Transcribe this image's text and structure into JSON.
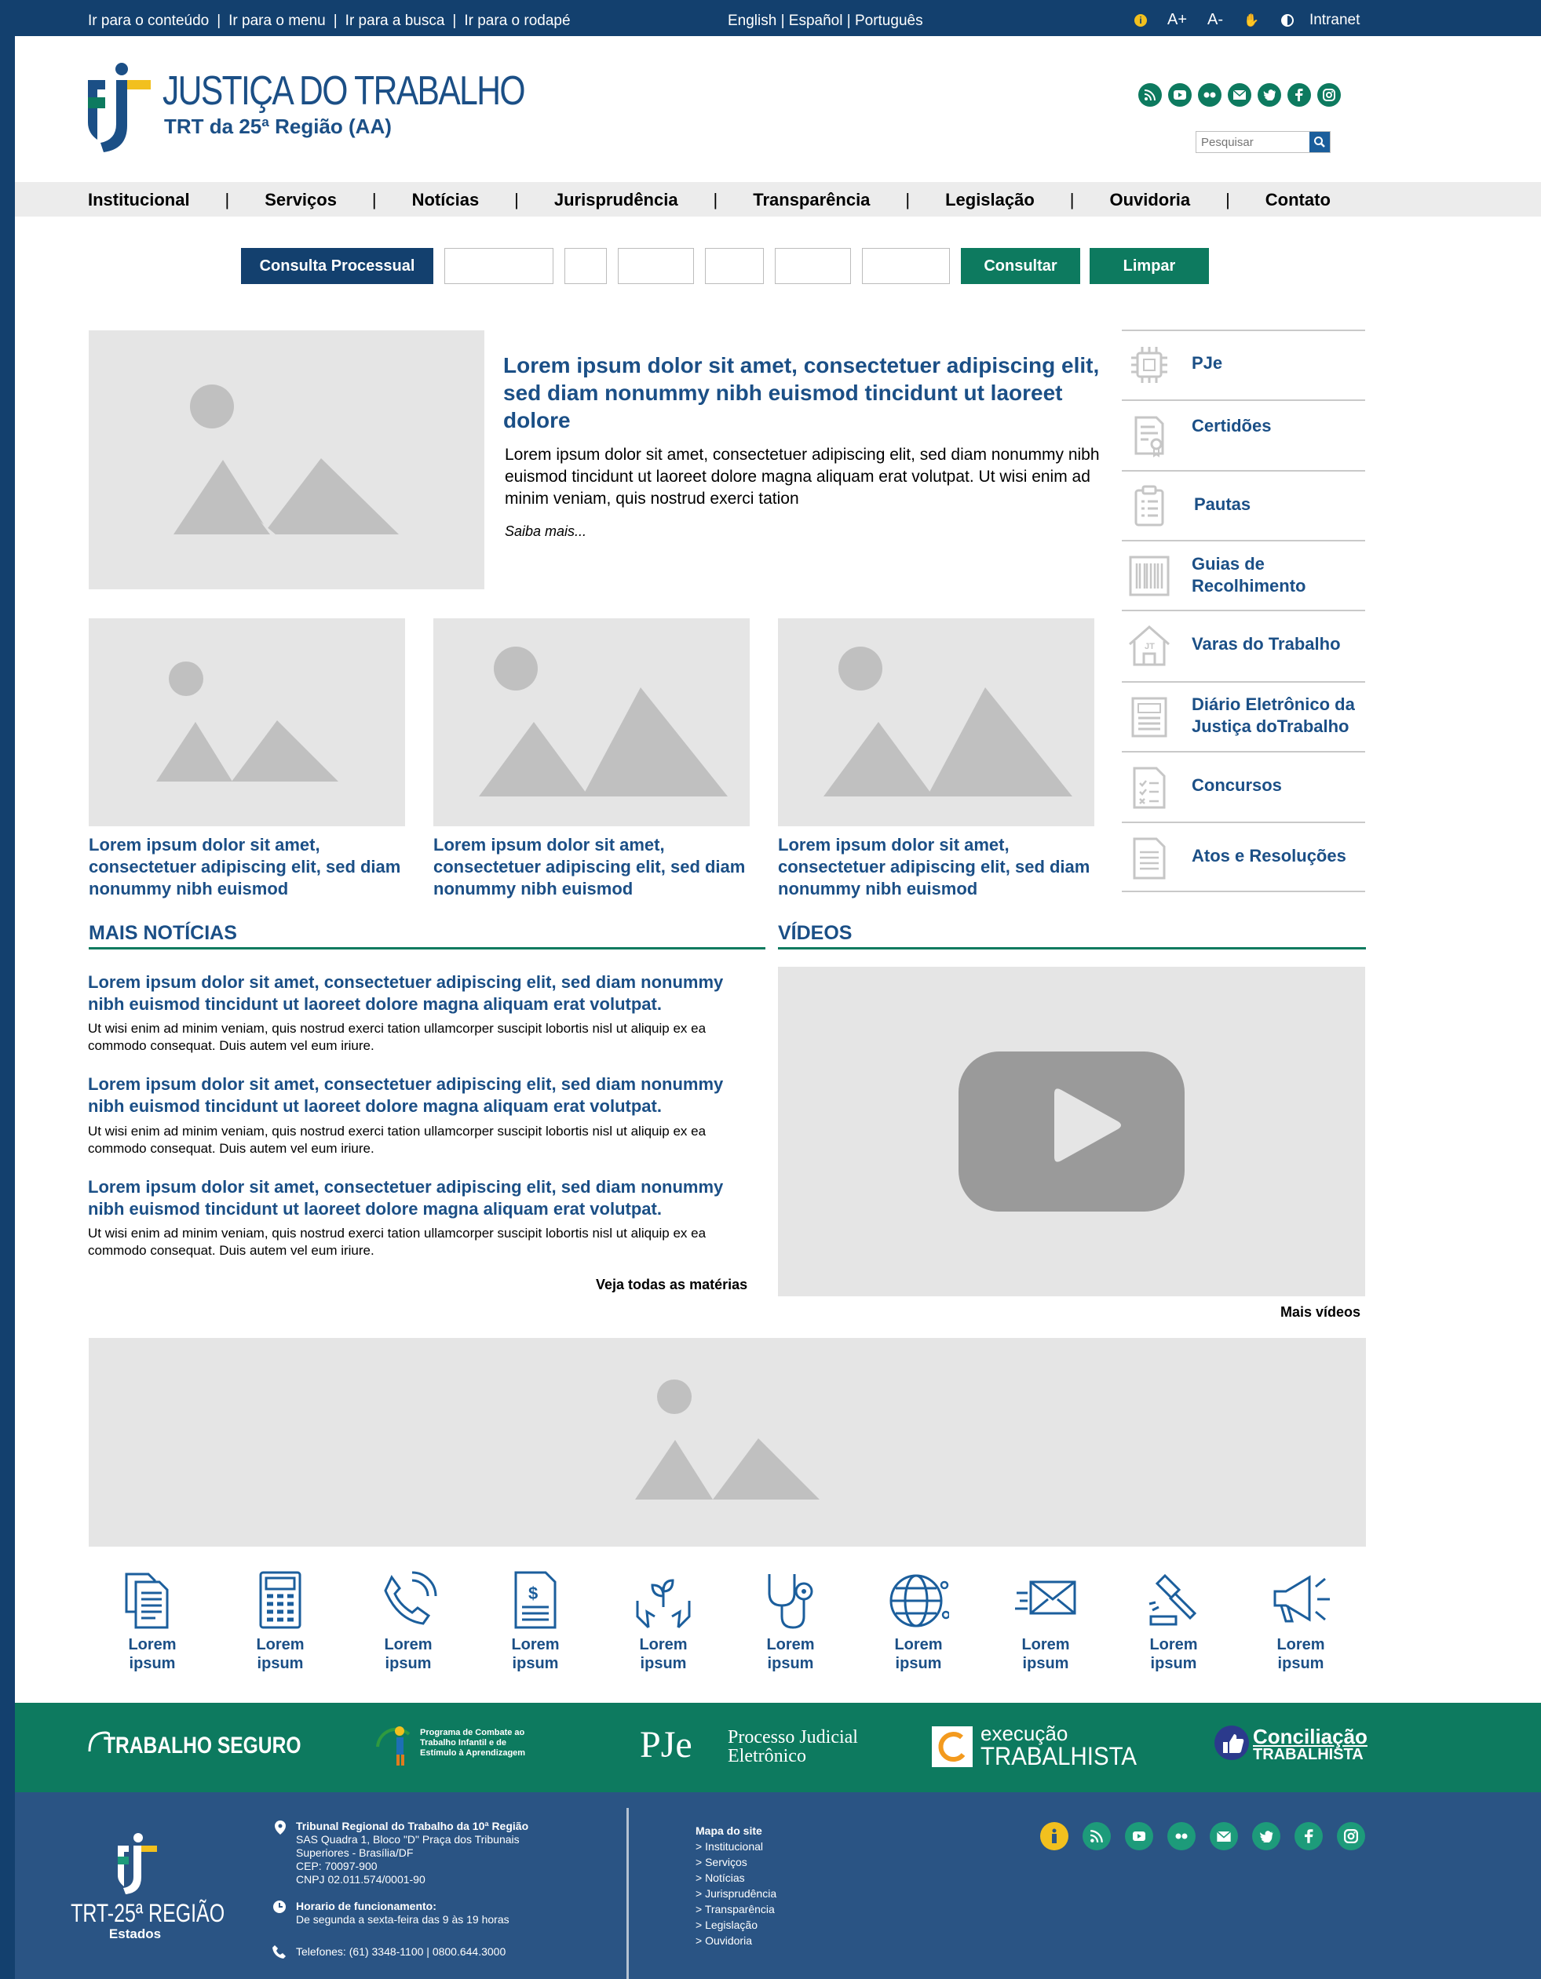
{
  "topbar": {
    "skip_links": [
      "Ir para o conteúdo",
      "Ir para o menu",
      "Ir para a busca",
      "Ir para o rodapé"
    ],
    "separator": "|",
    "languages": "English | Español | Português",
    "font_increase": "A+",
    "font_decrease": "A-",
    "intranet": "Intranet"
  },
  "header": {
    "logo_title": "JUSTIÇA DO TRABALHO",
    "logo_subtitle": "TRT da 25ª Região (AA)",
    "social_icons": [
      "rss-icon",
      "youtube-icon",
      "flickr-icon",
      "email-icon",
      "twitter-icon",
      "facebook-icon",
      "instagram-icon"
    ],
    "search_placeholder": "Pesquisar"
  },
  "nav": {
    "items": [
      "Institucional",
      "Serviços",
      "Notícias",
      "Jurisprudência",
      "Transparência",
      "Legislação",
      "Ouvidoria",
      "Contato"
    ],
    "separator": "|"
  },
  "consulta": {
    "label": "Consulta Processual",
    "consultar": "Consultar",
    "limpar": "Limpar"
  },
  "feature": {
    "title": "Lorem ipsum dolor sit amet, consectetuer adipiscing elit, sed diam nonummy nibh euismod tincidunt ut laoreet dolore",
    "text": "Lorem ipsum dolor sit amet, consectetuer adipiscing elit, sed diam nonummy nibh euismod tincidunt ut laoreet dolore magna aliquam erat volutpat. Ut wisi enim ad minim veniam, quis nostrud exerci tation",
    "more": "Saiba mais..."
  },
  "cards": [
    {
      "caption": "Lorem ipsum dolor sit amet, consectetuer adipiscing elit, sed diam nonummy nibh euismod"
    },
    {
      "caption": "Lorem ipsum dolor sit amet, consectetuer adipiscing elit, sed diam nonummy nibh euismod"
    },
    {
      "caption": "Lorem ipsum dolor sit amet, consectetuer adipiscing elit, sed diam nonummy nibh euismod"
    }
  ],
  "sidebar": {
    "items": [
      {
        "label": "PJe",
        "icon": "chip-icon"
      },
      {
        "label": "Certidões",
        "icon": "certificate-icon"
      },
      {
        "label": "Pautas",
        "icon": "clipboard-icon"
      },
      {
        "label": "Guias de Recolhimento",
        "icon": "barcode-icon"
      },
      {
        "label": "Varas do Trabalho",
        "icon": "building-icon"
      },
      {
        "label": "Diário Eletrônico da Justiça doTrabalho",
        "icon": "newspaper-icon"
      },
      {
        "label": "Concursos",
        "icon": "checklist-icon"
      },
      {
        "label": "Atos e Resoluções",
        "icon": "document-icon"
      }
    ]
  },
  "news": {
    "section_title": "MAIS NOTÍCIAS",
    "items": [
      {
        "title": "Lorem ipsum dolor sit amet, consectetuer adipiscing elit, sed diam nonummy nibh euismod tincidunt ut laoreet dolore magna aliquam erat volutpat.",
        "text": "Ut wisi enim ad minim veniam, quis nostrud exerci tation ullamcorper suscipit lobortis nisl ut aliquip ex ea commodo consequat. Duis autem vel eum iriure."
      },
      {
        "title": "Lorem ipsum dolor sit amet, consectetuer adipiscing elit, sed diam nonummy nibh euismod tincidunt ut laoreet dolore magna aliquam erat volutpat.",
        "text": "Ut wisi enim ad minim veniam, quis nostrud exerci tation ullamcorper suscipit lobortis nisl ut aliquip ex ea commodo consequat. Duis autem vel eum iriure."
      },
      {
        "title": "Lorem ipsum dolor sit amet, consectetuer adipiscing elit, sed diam nonummy nibh euismod tincidunt ut laoreet dolore magna aliquam erat volutpat.",
        "text": "Ut wisi enim ad minim veniam, quis nostrud exerci tation ullamcorper suscipit lobortis nisl ut aliquip ex ea commodo consequat. Duis autem vel eum iriure."
      }
    ],
    "all_link": "Veja todas as matérias"
  },
  "videos": {
    "section_title": "VÍDEOS",
    "more_link": "Mais vídeos"
  },
  "services": [
    {
      "label": "Lorem ipsum",
      "icon": "documents-icon"
    },
    {
      "label": "Lorem ipsum",
      "icon": "calculator-icon"
    },
    {
      "label": "Lorem ipsum",
      "icon": "phone-icon"
    },
    {
      "label": "Lorem ipsum",
      "icon": "invoice-icon"
    },
    {
      "label": "Lorem ipsum",
      "icon": "plant-hands-icon"
    },
    {
      "label": "Lorem ipsum",
      "icon": "stethoscope-icon"
    },
    {
      "label": "Lorem ipsum",
      "icon": "globe-icon"
    },
    {
      "label": "Lorem ipsum",
      "icon": "mail-icon"
    },
    {
      "label": "Lorem ipsum",
      "icon": "gavel-icon"
    },
    {
      "label": "Lorem ipsum",
      "icon": "megaphone-icon"
    }
  ],
  "partners": {
    "trabalho_seguro": "TRABALHO SEGURO",
    "programa": [
      "Programa de Combate ao",
      "Trabalho Infantil e de",
      "Estímulo à Aprendizagem"
    ],
    "pje_logo": "PJe",
    "pje_line1": "Processo Judicial",
    "pje_line2": "Eletrônico",
    "execucao_small": "execução",
    "execucao_big": "TRABALHISTA",
    "conciliacao_1": "Conciliação",
    "conciliacao_2": "TRABALHISTA"
  },
  "footer": {
    "logo_line1": "TRT-25ª REGIÃO",
    "logo_line2": "Estados",
    "address_title": "Tribunal Regional do Trabalho da 10ª Região",
    "address_lines": [
      "SAS Quadra 1, Bloco \"D\" Praça dos Tribunais",
      "Superiores - Brasília/DF",
      "CEP: 70097-900",
      "CNPJ 02.011.574/0001-90"
    ],
    "hours_title": "Horario de funcionamento:",
    "hours_text": "De segunda a sexta-feira das 9 às 19 horas",
    "phones": "Telefones: (61) 3348-1100 | 0800.644.3000",
    "sitemap_title": "Mapa do site",
    "sitemap_items": [
      "> Institucional",
      "> Serviços",
      "> Notícias",
      "> Jurisprudência",
      "> Transparência",
      "> Legislação",
      "> Ouvidoria"
    ]
  },
  "colors": {
    "navy": "#13406e",
    "blue_text": "#1b4f86",
    "green": "#0d7a5f",
    "footer": "#2a5484",
    "yellow": "#f2c01e"
  }
}
